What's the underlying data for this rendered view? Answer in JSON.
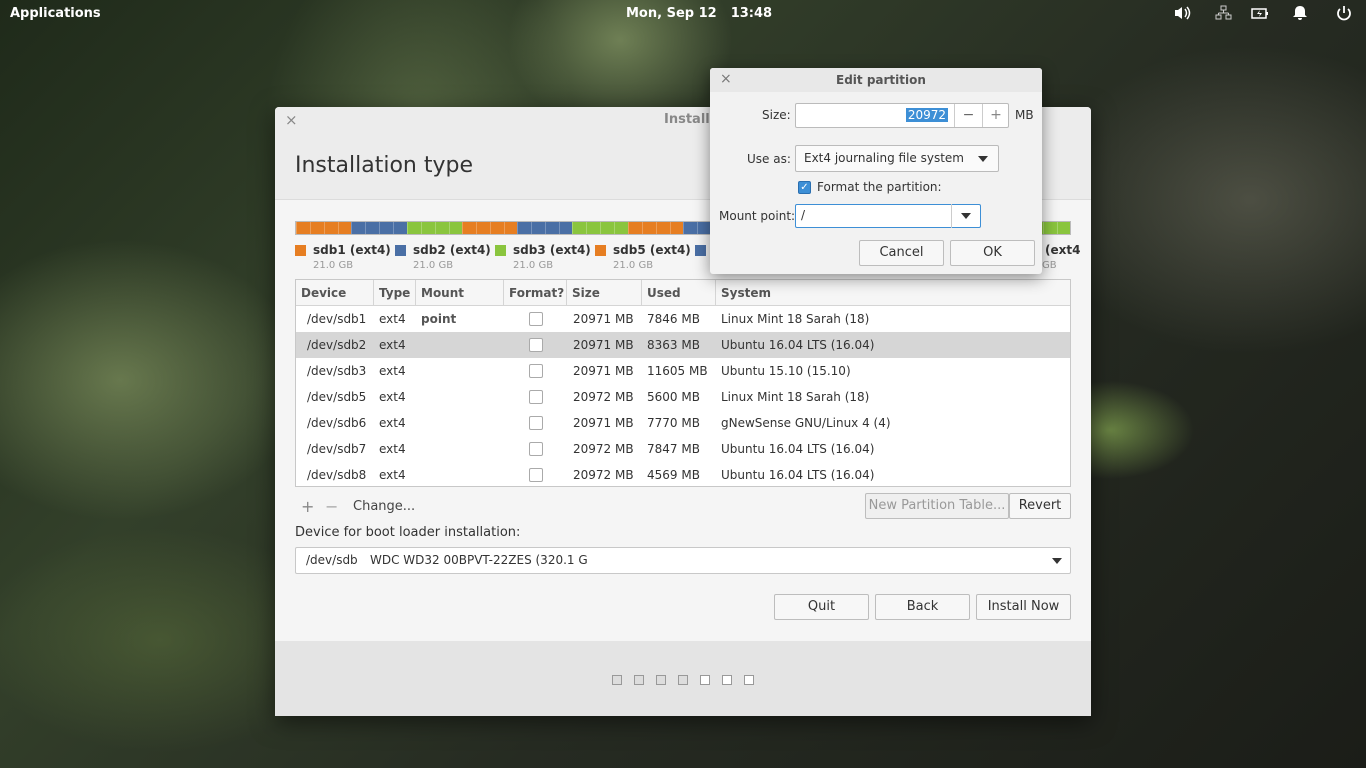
{
  "panel": {
    "applications": "Applications",
    "date": "Mon, Sep 12",
    "time": "13:48",
    "indicators": [
      "volume-icon",
      "network-icon",
      "battery-icon",
      "notification-icon",
      "power-icon"
    ]
  },
  "installer": {
    "window_title": "Install",
    "heading": "Installation type",
    "partition_bar_colors": [
      "#e67e22",
      "#4a6fa5",
      "#8ac53e",
      "#e67e22",
      "#4a6fa5",
      "#8ac53e",
      "#e67e22",
      "#4a6fa5",
      "#8ac53e",
      "#e67e22",
      "#4a6fa5",
      "#8ac53e",
      "#e67e22",
      "#8ac53e"
    ],
    "legend": [
      {
        "name": "sdb1 (ext4)",
        "size": "21.0 GB",
        "color": "#e67e22"
      },
      {
        "name": "sdb2 (ext4)",
        "size": "21.0 GB",
        "color": "#4a6fa5"
      },
      {
        "name": "sdb3 (ext4)",
        "size": "21.0 GB",
        "color": "#8ac53e"
      },
      {
        "name": "sdb5 (ext4)",
        "size": "21.0 GB",
        "color": "#e67e22"
      },
      {
        "name": "",
        "size": "",
        "color": "#4a6fa5"
      },
      {
        "name": "(ext4",
        "size": "GB",
        "color": ""
      }
    ],
    "columns": [
      "Device",
      "Type",
      "Mount point",
      "Format?",
      "Size",
      "Used",
      "System"
    ],
    "rows": [
      {
        "device": "/dev/sdb1",
        "type": "ext4",
        "mount": "",
        "size": "20971 MB",
        "used": "7846 MB",
        "system": "Linux Mint 18 Sarah (18)"
      },
      {
        "device": "/dev/sdb2",
        "type": "ext4",
        "mount": "",
        "size": "20971 MB",
        "used": "8363 MB",
        "system": "Ubuntu 16.04 LTS (16.04)"
      },
      {
        "device": "/dev/sdb3",
        "type": "ext4",
        "mount": "",
        "size": "20971 MB",
        "used": "11605 MB",
        "system": "Ubuntu 15.10 (15.10)"
      },
      {
        "device": "/dev/sdb5",
        "type": "ext4",
        "mount": "",
        "size": "20972 MB",
        "used": "5600 MB",
        "system": "Linux Mint 18 Sarah (18)"
      },
      {
        "device": "/dev/sdb6",
        "type": "ext4",
        "mount": "",
        "size": "20971 MB",
        "used": "7770 MB",
        "system": "gNewSense GNU/Linux 4 (4)"
      },
      {
        "device": "/dev/sdb7",
        "type": "ext4",
        "mount": "",
        "size": "20972 MB",
        "used": "7847 MB",
        "system": "Ubuntu 16.04 LTS (16.04)"
      },
      {
        "device": "/dev/sdb8",
        "type": "ext4",
        "mount": "",
        "size": "20972 MB",
        "used": "4569 MB",
        "system": "Ubuntu 16.04 LTS (16.04)"
      }
    ],
    "tools": {
      "add": "+",
      "remove": "−",
      "change": "Change...",
      "new_table": "New Partition Table...",
      "revert": "Revert"
    },
    "boot_label": "Device for boot loader installation:",
    "boot_device": "/dev/sdb",
    "boot_name": "WDC WD32 00BPVT-22ZES (320.1 G",
    "buttons": {
      "quit": "Quit",
      "back": "Back",
      "install": "Install Now"
    },
    "progress_steps": 7,
    "progress_filled": 4
  },
  "dialog": {
    "title": "Edit partition",
    "size_label": "Size:",
    "size_value": "20972",
    "size_unit": "MB",
    "minus": "−",
    "plus": "+",
    "use_as_label": "Use as:",
    "use_as_value": "Ext4 journaling file system",
    "format_label": "Format the partition:",
    "format_checked": true,
    "mount_label": "Mount point:",
    "mount_value": "/",
    "cancel": "Cancel",
    "ok": "OK"
  }
}
